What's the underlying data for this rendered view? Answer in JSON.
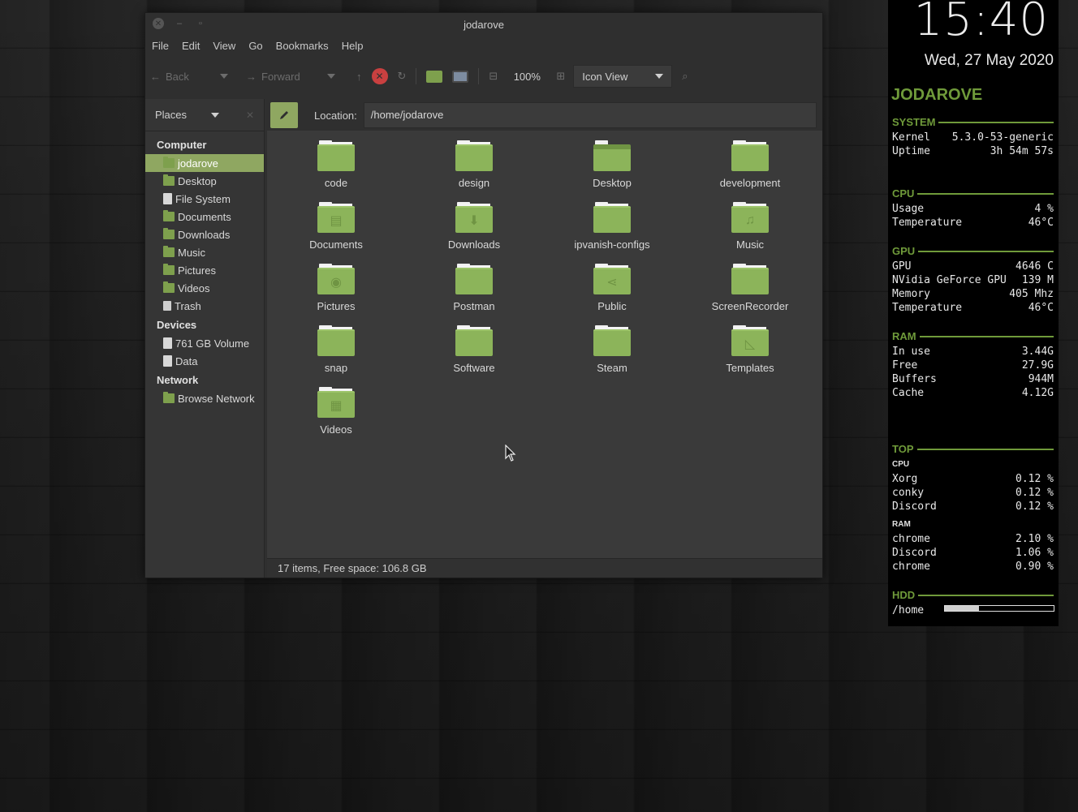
{
  "window": {
    "title": "jodarove",
    "menu": [
      "File",
      "Edit",
      "View",
      "Go",
      "Bookmarks",
      "Help"
    ],
    "toolbar": {
      "back": "Back",
      "forward": "Forward",
      "zoom": "100%",
      "view_mode": "Icon View"
    },
    "sidebar": {
      "header": "Places",
      "groups": [
        {
          "label": "Computer",
          "items": [
            {
              "label": "jodarove",
              "icon": "home-icon",
              "active": true
            },
            {
              "label": "Desktop",
              "icon": "desktop-folder-icon"
            },
            {
              "label": "File System",
              "icon": "drive-icon"
            },
            {
              "label": "Documents",
              "icon": "documents-folder-icon"
            },
            {
              "label": "Downloads",
              "icon": "downloads-folder-icon"
            },
            {
              "label": "Music",
              "icon": "music-folder-icon"
            },
            {
              "label": "Pictures",
              "icon": "pictures-folder-icon"
            },
            {
              "label": "Videos",
              "icon": "videos-folder-icon"
            },
            {
              "label": "Trash",
              "icon": "trash-icon"
            }
          ]
        },
        {
          "label": "Devices",
          "items": [
            {
              "label": "761 GB Volume",
              "icon": "drive-icon"
            },
            {
              "label": "Data",
              "icon": "drive-icon"
            }
          ]
        },
        {
          "label": "Network",
          "items": [
            {
              "label": "Browse Network",
              "icon": "network-folder-icon"
            }
          ]
        }
      ]
    },
    "location": {
      "label": "Location:",
      "path": "/home/jodarove"
    },
    "files": [
      {
        "name": "code",
        "glyph": ""
      },
      {
        "name": "design",
        "glyph": ""
      },
      {
        "name": "Desktop",
        "glyph": ""
      },
      {
        "name": "development",
        "glyph": ""
      },
      {
        "name": "Documents",
        "glyph": "▤"
      },
      {
        "name": "Downloads",
        "glyph": "⬇"
      },
      {
        "name": "ipvanish-configs",
        "glyph": ""
      },
      {
        "name": "Music",
        "glyph": "♫"
      },
      {
        "name": "Pictures",
        "glyph": "◉"
      },
      {
        "name": "Postman",
        "glyph": ""
      },
      {
        "name": "Public",
        "glyph": "⋖"
      },
      {
        "name": "ScreenRecorder",
        "glyph": ""
      },
      {
        "name": "snap",
        "glyph": ""
      },
      {
        "name": "Software",
        "glyph": ""
      },
      {
        "name": "Steam",
        "glyph": ""
      },
      {
        "name": "Templates",
        "glyph": "◺"
      },
      {
        "name": "Videos",
        "glyph": "▦"
      }
    ],
    "status": "17 items, Free space: 106.8 GB"
  },
  "conky": {
    "time": "15:40",
    "date": "Wed, 27 May 2020",
    "hostname": "JODAROVE",
    "system": {
      "header": "SYSTEM",
      "rows": [
        [
          "Kernel",
          "5.3.0-53-generic"
        ],
        [
          "Uptime",
          "3h 54m 57s"
        ]
      ]
    },
    "cpu": {
      "header": "CPU",
      "rows": [
        [
          "Usage",
          "4 %"
        ],
        [
          "Temperature",
          "46°C"
        ]
      ]
    },
    "gpu": {
      "header": "GPU",
      "rows": [
        [
          "GPU",
          "4646 C"
        ],
        [
          "NVidia GeForce GPU",
          "139 M"
        ],
        [
          "Memory",
          "405 Mhz"
        ],
        [
          "Temperature",
          "46°C"
        ]
      ]
    },
    "ram": {
      "header": "RAM",
      "rows": [
        [
          "In use",
          "3.44G"
        ],
        [
          "Free",
          "27.9G"
        ],
        [
          "Buffers",
          "944M"
        ],
        [
          "Cache",
          "4.12G"
        ]
      ]
    },
    "top": {
      "header": "TOP",
      "cpu_label": "CPU",
      "cpu_rows": [
        [
          "Xorg",
          "0.12 %"
        ],
        [
          "conky",
          "0.12 %"
        ],
        [
          "Discord",
          "0.12 %"
        ]
      ],
      "ram_label": "RAM",
      "ram_rows": [
        [
          "chrome",
          "2.10 %"
        ],
        [
          "Discord",
          "1.06 %"
        ],
        [
          "chrome",
          "0.90 %"
        ]
      ]
    },
    "hdd": {
      "header": "HDD",
      "mount": "/home",
      "usage_fraction": 0.31
    }
  },
  "colors": {
    "accent": "#8fa761",
    "folder": "#8cb45a",
    "conky_green": "#6f9a3a"
  }
}
